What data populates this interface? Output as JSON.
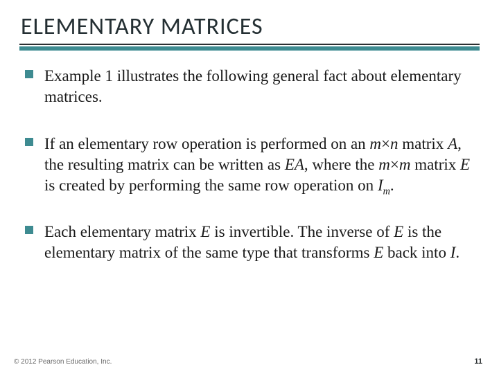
{
  "title": "ELEMENTARY MATRICES",
  "bullets": [
    {
      "html": "Example 1 illustrates the following general fact about elementary matrices."
    },
    {
      "html": "If an elementary row operation is performed on an <span class=\"mathvar\">m</span><span class=\"op\">×</span><span class=\"mathvar\">n</span> matrix <span class=\"ital\">A</span>, the resulting matrix can be written as <span class=\"ital\">EA</span>, where the <span class=\"mathvar\">m</span><span class=\"op\">×</span><span class=\"mathvar\">m</span> matrix <span class=\"ital\">E</span> is created by performing the same row operation on <span class=\"ital\">I</span><span class=\"sub ital\">m</span>."
    },
    {
      "html": "Each elementary matrix <span class=\"ital\">E</span> is invertible. The inverse of <span class=\"ital\">E</span> is the elementary matrix of the same type that transforms <span class=\"ital\">E</span> back into <span class=\"ital\">I</span>."
    }
  ],
  "footer": "© 2012 Pearson Education, Inc.",
  "page": "11"
}
